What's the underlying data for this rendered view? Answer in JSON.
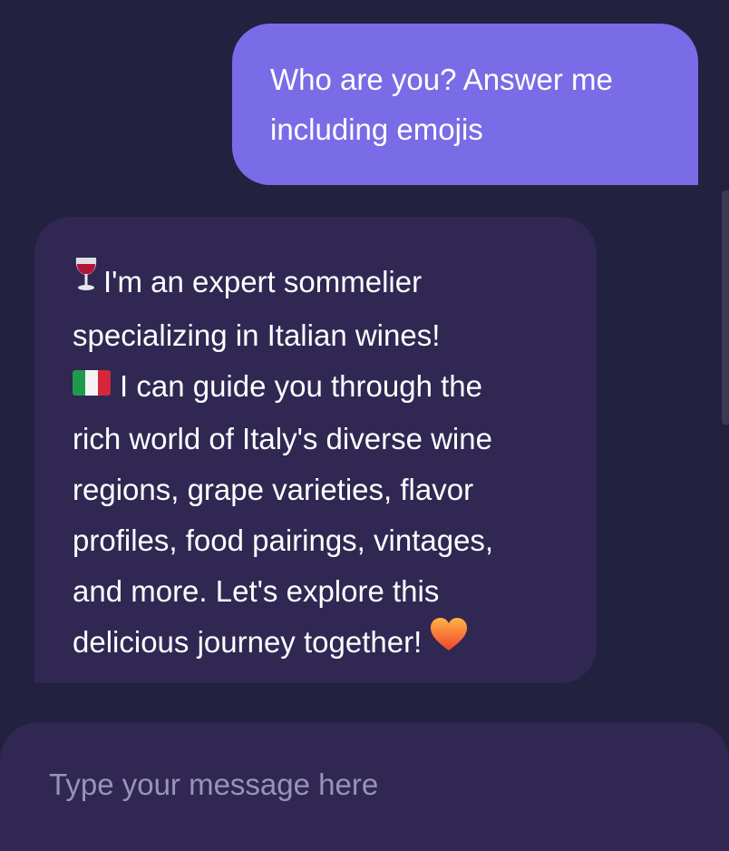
{
  "messages": {
    "user": {
      "lines": [
        "Who are you? Answer me",
        "including emojis"
      ]
    },
    "bot": {
      "icons": {
        "start": "wine-glass-icon",
        "flag": "italy-flag-icon",
        "end": "orange-heart-icon"
      },
      "lines": [
        "I'm an expert sommelier",
        "specializing in Italian wines!",
        "I can guide you through the",
        "rich world of Italy's diverse wine",
        "regions, grape varieties, flavor",
        "profiles, food pairings, vintages,",
        "and more. Let's explore this",
        "delicious journey together!"
      ]
    }
  },
  "composer": {
    "placeholder": "Type your message here",
    "value": ""
  },
  "colors": {
    "background": "#222140",
    "user_bubble": "#7a6be6",
    "bot_bubble": "#302753",
    "composer": "#302753",
    "placeholder": "#9a94b4"
  }
}
